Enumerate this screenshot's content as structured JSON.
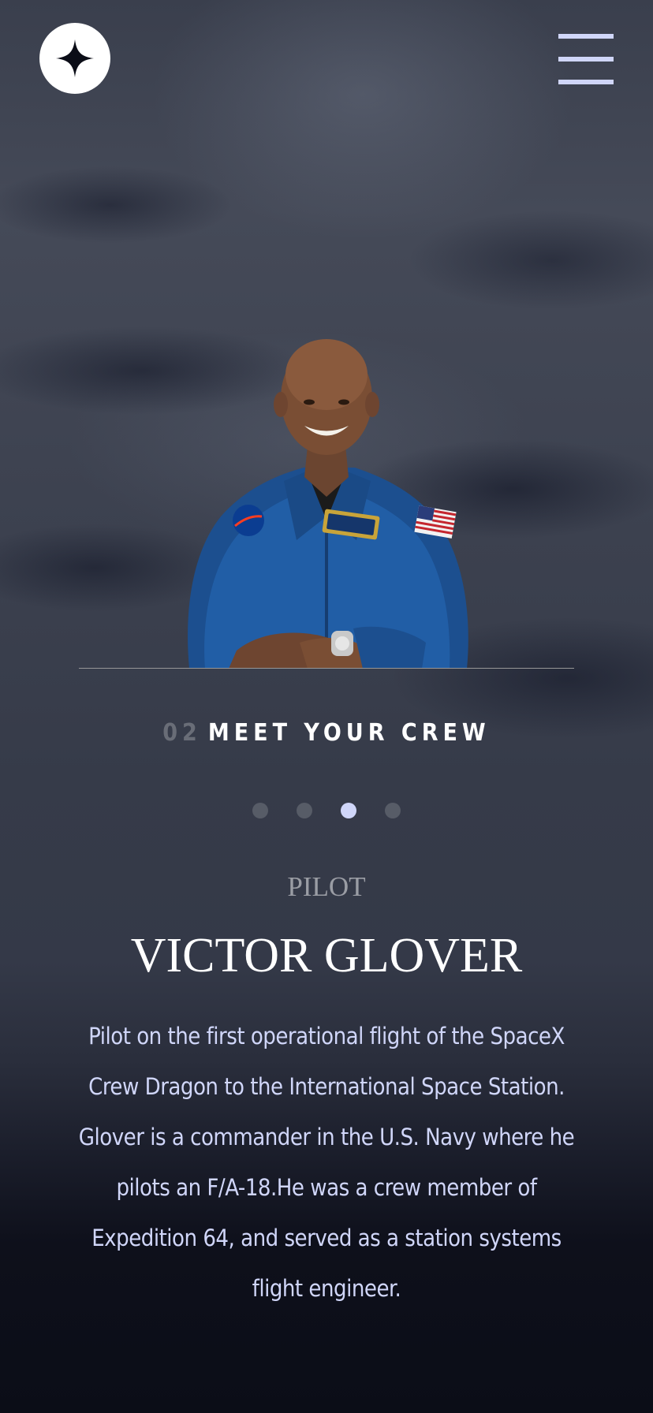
{
  "header": {
    "logo_icon": "four-point-star-icon",
    "menu_icon": "hamburger-menu-icon"
  },
  "page_heading": {
    "number": "02",
    "title": "MEET YOUR CREW"
  },
  "carousel": {
    "dots": [
      {
        "label": "crew-1",
        "active": false
      },
      {
        "label": "crew-2",
        "active": false
      },
      {
        "label": "crew-3",
        "active": true
      },
      {
        "label": "crew-4",
        "active": false
      }
    ]
  },
  "crew": {
    "role": "PILOT",
    "name": "VICTOR GLOVER",
    "bio": "Pilot on the first operational flight of the SpaceX Crew Dragon to the International Space Station. Glover is a commander in the U.S. Navy where he pilots an F/A-18.He was a crew member of Expedition 64, and served as a station systems flight engineer."
  },
  "colors": {
    "background": "#0b0d17",
    "accent": "#d0d6f9",
    "white": "#ffffff"
  }
}
